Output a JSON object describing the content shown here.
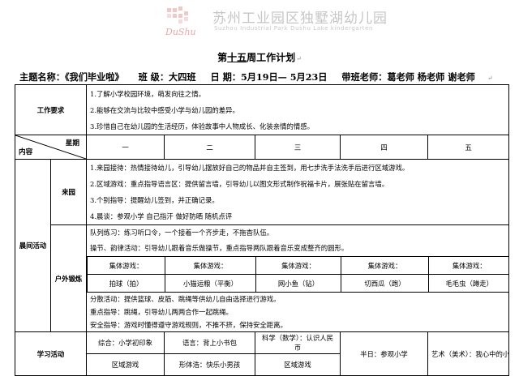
{
  "logo": {
    "script_text": "DuShu",
    "name_cn": "苏州工业园区独墅湖幼儿园",
    "name_en": "Suzhou Industrial Park Dushu Lake kindergarten"
  },
  "document_title": {
    "prefix": "第",
    "week_num": "十五",
    "suffix": "周工作计划"
  },
  "header": {
    "theme": "主题名称：《我们毕业啦》",
    "class": "班  级：大四班",
    "date": "日  期：5月19日— 5月23日",
    "teachers": "带班老师：葛老师  杨老师  谢老师"
  },
  "table": {
    "work_requirements_label": "工作要求",
    "work_requirements": [
      "1.了解小学校园环境，萌发向往之情。",
      "2.能够在交流与比较中感受小学与幼儿园的差异。",
      "3.珍惜自己在幼儿园的生活经历，体验故事中人物成长、化装亲情的情感。"
    ],
    "diag_top": "星期",
    "diag_bottom": "内容",
    "weekdays": [
      "一",
      "二",
      "三",
      "四",
      "五"
    ],
    "morning_label": "晨间活动",
    "arrival_label": "来园",
    "arrival_items": [
      "1.来园接待：热情接待幼儿，引导幼儿摆放好自己的物品并自主签到，用七步洗手法洗手后进行区域游戏。",
      "2.区域游戏：重点指导语言区：提供留言墙，引导幼儿以图文形式制作祝福卡片，展张贴在留言墙。",
      "3.个别指导：提醒幼儿签到，并正确记录。",
      "4.晨谈：参观小学   自己指汗   做好防晒  随机点评"
    ],
    "outdoor_label": "户外锻炼",
    "outdoor_intro": [
      "队列练习：练习听口令，一个接着一个齐步走，不拖杳队伍。",
      "操节、韵律活动：引导幼儿跟着音乐做操节，重点指导两队跟着音乐变成整齐的圆形。"
    ],
    "group_games_heading": "集体游戏：",
    "group_games": [
      "拍球（拍）",
      "小猫运粮（平衡）",
      "网小鱼（钻）",
      "切西瓜（跑）",
      "毛毛虫（蹲走）"
    ],
    "outdoor_after": [
      "分散活动：提供篮球、皮筋、跳绳等供幼儿自由选择进行游戏。",
      "重点指导：跳绳，引导幼儿两两合作一起跳绳。",
      "安全指导：游戏时懂得遵守游戏规则，不推不挤，保持安全距离。"
    ],
    "study_label": "学习活动",
    "study_row1": [
      "综合：小学初印象",
      "语言：背上小书包",
      "科学（数学）：认识人民币"
    ],
    "study_row2": [
      "区域游戏",
      "形体浩：快乐小男孩",
      "区域游戏"
    ],
    "study_thu": "半日：参观小学",
    "study_fri": "艺术（美术）：我心中的小学"
  }
}
